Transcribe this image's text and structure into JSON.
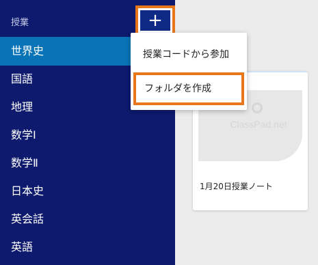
{
  "sidebar": {
    "header": "授業",
    "items": [
      {
        "label": "世界史"
      },
      {
        "label": "国語"
      },
      {
        "label": "地理"
      },
      {
        "label": "数学Ⅰ"
      },
      {
        "label": "数学Ⅱ"
      },
      {
        "label": "日本史"
      },
      {
        "label": "英会話"
      },
      {
        "label": "英語"
      }
    ]
  },
  "toolbar": {
    "add_label": "+"
  },
  "menu": {
    "items": [
      {
        "label": "授業コードから参加"
      },
      {
        "label": "フォルダを作成"
      }
    ]
  },
  "card": {
    "watermark": "ClassPad.net",
    "more": "…",
    "title": "1月20日授業ノート"
  },
  "colors": {
    "sidebar_bg": "#0d1a6e",
    "active_bg": "#0873b6",
    "highlight": "#e8771c"
  }
}
